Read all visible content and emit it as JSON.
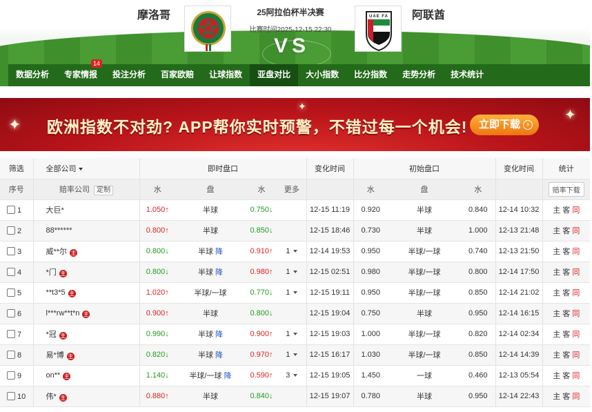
{
  "match": {
    "home_team": "摩洛哥",
    "away_team": "阿联酋",
    "title": "25阿拉伯杯半决赛",
    "time_label": "比赛时间2025-12-15 22:30",
    "vs": "VS",
    "away_logo_text": "UAE FA"
  },
  "colors": {
    "nav_bg": "#236a1a",
    "up": "#e02020",
    "down": "#1f9a1f",
    "link": "#2255cc"
  },
  "nav": [
    {
      "label": "数据分析"
    },
    {
      "label": "专家情报",
      "badge": "14"
    },
    {
      "label": "投注分析"
    },
    {
      "label": "百家欧赔"
    },
    {
      "label": "让球指数"
    },
    {
      "label": "亚盘对比",
      "active": true
    },
    {
      "label": "大小指数"
    },
    {
      "label": "比分指数"
    },
    {
      "label": "走势分析"
    },
    {
      "label": "技术统计"
    }
  ],
  "banner": {
    "text": "欧洲指数不对劲? APP帮你实时预警，不错过每一个机会!",
    "button": "立即下载"
  },
  "table": {
    "head1": {
      "filter": "筛选",
      "company_select": "全部公司",
      "live": "即时盘口",
      "change_time": "变化时间",
      "initial": "初始盘口",
      "change_time2": "变化时间",
      "stats": "统计"
    },
    "head2": {
      "index": "序号",
      "company": "赔率公司",
      "custom": "定制",
      "water1": "水",
      "pan": "盘",
      "water2": "水",
      "more": "更多",
      "i_water1": "水",
      "i_pan": "盘",
      "i_water2": "水",
      "odds_download": "赔率下载"
    },
    "action_labels": {
      "home": "主",
      "away": "客",
      "same": "同"
    },
    "zhu_label": "主",
    "drop_label": "降",
    "rows": [
      {
        "n": "1",
        "company": "大巨*",
        "zhu": false,
        "w1": "1.050",
        "w1d": "up",
        "pan": "半球",
        "drop": false,
        "w2": "0.750",
        "w2d": "down",
        "more": "",
        "time": "12-15 11:19",
        "iw1": "0.920",
        "ipan": "半球",
        "iw2": "0.840",
        "itime": "12-14 10:32"
      },
      {
        "n": "2",
        "company": "88******",
        "zhu": false,
        "w1": "0.800",
        "w1d": "up",
        "pan": "半球",
        "drop": false,
        "w2": "0.850",
        "w2d": "down",
        "more": "",
        "time": "12-15 18:46",
        "iw1": "0.730",
        "ipan": "半球",
        "iw2": "1.000",
        "itime": "12-13 21:48"
      },
      {
        "n": "3",
        "company": "威**尔",
        "zhu": true,
        "w1": "0.800",
        "w1d": "down",
        "pan": "半球",
        "drop": true,
        "w2": "0.910",
        "w2d": "up",
        "more": "1",
        "time": "12-14 19:53",
        "iw1": "0.950",
        "ipan": "半球/一球",
        "iw2": "0.740",
        "itime": "12-13 21:50"
      },
      {
        "n": "4",
        "company": "*门",
        "zhu": true,
        "w1": "0.800",
        "w1d": "down",
        "pan": "半球",
        "drop": true,
        "w2": "0.980",
        "w2d": "up",
        "more": "1",
        "time": "12-15 02:51",
        "iw1": "0.980",
        "ipan": "半球/一球",
        "iw2": "0.800",
        "itime": "12-14 17:50"
      },
      {
        "n": "5",
        "company": "**t3*5",
        "zhu": true,
        "w1": "1.020",
        "w1d": "up",
        "pan": "半球/一球",
        "drop": false,
        "w2": "0.770",
        "w2d": "down",
        "more": "1",
        "time": "12-15 19:11",
        "iw1": "0.950",
        "ipan": "半球/一球",
        "iw2": "0.850",
        "itime": "12-14 21:02"
      },
      {
        "n": "6",
        "company": "l***rw**t*n",
        "zhu": true,
        "w1": "0.900",
        "w1d": "up",
        "pan": "半球",
        "drop": false,
        "w2": "0.800",
        "w2d": "down",
        "more": "",
        "time": "12-15 19:04",
        "iw1": "0.750",
        "ipan": "半球",
        "iw2": "0.950",
        "itime": "12-14 16:15"
      },
      {
        "n": "7",
        "company": "*冠",
        "zhu": true,
        "w1": "0.990",
        "w1d": "down",
        "pan": "半球",
        "drop": true,
        "w2": "0.900",
        "w2d": "up",
        "more": "1",
        "time": "12-15 19:03",
        "iw1": "1.000",
        "ipan": "半球/一球",
        "iw2": "0.820",
        "itime": "12-14 02:34"
      },
      {
        "n": "8",
        "company": "易*博",
        "zhu": true,
        "w1": "0.820",
        "w1d": "down",
        "pan": "半球",
        "drop": true,
        "w2": "0.970",
        "w2d": "up",
        "more": "1",
        "time": "12-15 16:17",
        "iw1": "1.030",
        "ipan": "半球/一球",
        "iw2": "0.850",
        "itime": "12-14 14:39"
      },
      {
        "n": "9",
        "company": "on**",
        "zhu": true,
        "w1": "1.140",
        "w1d": "down",
        "pan": "半球/一球",
        "drop": true,
        "w2": "0.590",
        "w2d": "up",
        "more": "3",
        "time": "12-15 19:05",
        "iw1": "1.450",
        "ipan": "一球",
        "iw2": "0.460",
        "itime": "12-13 05:54"
      },
      {
        "n": "10",
        "company": "伟*",
        "zhu": true,
        "w1": "0.880",
        "w1d": "up",
        "pan": "半球",
        "drop": false,
        "w2": "0.840",
        "w2d": "down",
        "more": "",
        "time": "12-15 19:07",
        "iw1": "0.780",
        "ipan": "半球",
        "iw2": "0.950",
        "itime": "12-14 22:43"
      }
    ]
  }
}
